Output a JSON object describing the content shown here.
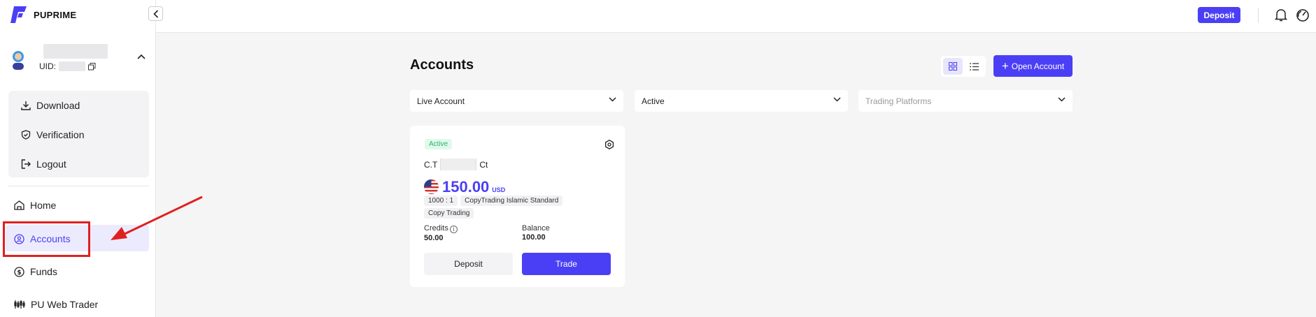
{
  "brand": {
    "name": "PUPRIME",
    "color": "#4b3ff6"
  },
  "user": {
    "uid_label": "UID:"
  },
  "sidebar": {
    "menu": [
      {
        "label": "Download",
        "icon": "download-icon"
      },
      {
        "label": "Verification",
        "icon": "shield-check-icon"
      },
      {
        "label": "Logout",
        "icon": "logout-icon"
      }
    ],
    "nav": [
      {
        "label": "Home",
        "icon": "home-icon"
      },
      {
        "label": "Accounts",
        "icon": "user-circle-icon",
        "active": true
      },
      {
        "label": "Funds",
        "icon": "dollar-circle-icon"
      },
      {
        "label": "PU Web Trader",
        "icon": "web-trader-icon"
      }
    ]
  },
  "topbar": {
    "deposit_label": "Deposit"
  },
  "main": {
    "title": "Accounts",
    "open_account_label": "Open Account",
    "filters": [
      {
        "value": "Live Account",
        "placeholder": false
      },
      {
        "value": "Active",
        "placeholder": false
      },
      {
        "value": "Trading Platforms",
        "placeholder": true
      }
    ]
  },
  "card": {
    "status": "Active",
    "account_prefix": "C.T",
    "account_suffix": "Ct",
    "balance": "150.00",
    "currency": "USD",
    "leverage": "1000 : 1",
    "account_type": "CopyTrading Islamic Standard",
    "tag": "Copy Trading",
    "credits_label": "Credits",
    "credits_value": "50.00",
    "balance_label": "Balance",
    "balance_value": "100.00",
    "deposit_label": "Deposit",
    "trade_label": "Trade"
  },
  "colors": {
    "accent": "#4b3ff6",
    "active_badge": "#26b46b",
    "annotation": "#e02020"
  }
}
